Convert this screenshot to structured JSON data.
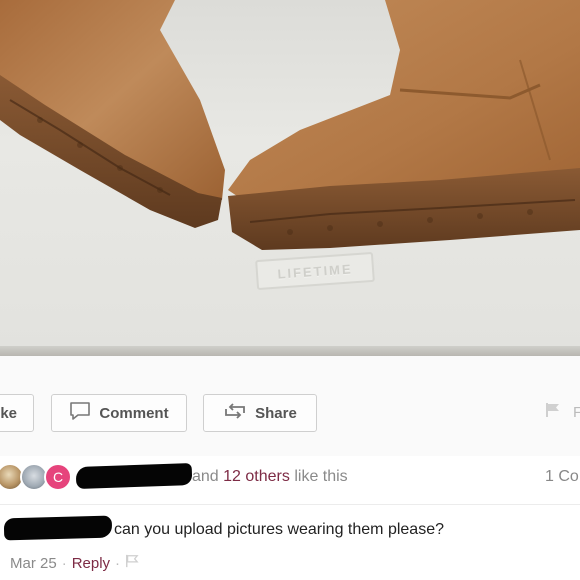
{
  "photo": {
    "stamp_text": "LIFETIME"
  },
  "actions": {
    "like_label": "Like",
    "comment_label": "Comment",
    "share_label": "Share",
    "right_partial_label": "F"
  },
  "likes": {
    "avatar_letter": "C",
    "prefix": "and",
    "count_text": "12 others",
    "suffix": "like this",
    "comments_count": "1 Co"
  },
  "comment": {
    "text": "can you upload pictures wearing them please?",
    "date": "Mar 25",
    "separator": "·",
    "reply_label": "Reply"
  },
  "colors": {
    "accent": "#7d2b45",
    "avatar_pink": "#e6447c",
    "boot_suede": "#b67c4c"
  }
}
